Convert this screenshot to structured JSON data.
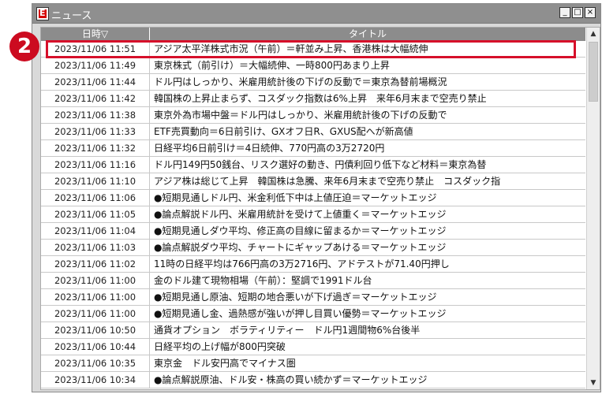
{
  "window": {
    "title": "ニュース",
    "minimize_label": "_",
    "maximize_label": "□",
    "close_label": "×"
  },
  "callout": {
    "number": "2"
  },
  "table": {
    "columns": {
      "date": "日時▽",
      "title": "タイトル"
    },
    "rows": [
      {
        "date": "2023/11/06 11:51",
        "title": "アジア太平洋株式市況（午前）＝軒並み上昇、香港株は大幅続伸"
      },
      {
        "date": "2023/11/06 11:49",
        "title": "東京株式（前引け）＝大幅続伸、一時800円あまり上昇"
      },
      {
        "date": "2023/11/06 11:44",
        "title": "ドル円はしっかり、米雇用統計後の下げの反動で＝東京為替前場概況"
      },
      {
        "date": "2023/11/06 11:42",
        "title": "韓国株の上昇止まらず、コスダック指数は6%上昇　来年6月末まで空売り禁止"
      },
      {
        "date": "2023/11/06 11:38",
        "title": "東京外為市場中盤＝ドル円はしっかり、米雇用統計後の下げの反動で"
      },
      {
        "date": "2023/11/06 11:33",
        "title": "ETF売買動向＝6日前引け、GXオフ日R、GXUS配へが新高値"
      },
      {
        "date": "2023/11/06 11:32",
        "title": "日経平均6日前引け＝4日続伸、770円高の3万2720円"
      },
      {
        "date": "2023/11/06 11:16",
        "title": "ドル円149円50銭台、リスク選好の動き、円債利回り低下など材料＝東京為替"
      },
      {
        "date": "2023/11/06 11:10",
        "title": "アジア株は総じて上昇　韓国株は急騰、来年6月末まで空売り禁止　コスダック指"
      },
      {
        "date": "2023/11/06 11:06",
        "title": "●短期見通しドル円、米金利低下中は上値圧迫＝マーケットエッジ"
      },
      {
        "date": "2023/11/06 11:05",
        "title": "●論点解説ドル円、米雇用統計を受けて上値重く＝マーケットエッジ"
      },
      {
        "date": "2023/11/06 11:04",
        "title": "●短期見通しダウ平均、修正高の目線に留まるか＝マーケットエッジ"
      },
      {
        "date": "2023/11/06 11:03",
        "title": "●論点解説ダウ平均、チャートにギャップあける＝マーケットエッジ"
      },
      {
        "date": "2023/11/06 11:02",
        "title": "11時の日経平均は766円高の3万2716円、アドテストが71.40円押し"
      },
      {
        "date": "2023/11/06 11:00",
        "title": "金のドル建て現物相場（午前）：堅調で1991ドル台"
      },
      {
        "date": "2023/11/06 11:00",
        "title": "●短期見通し原油、短期の地合悪いが下げ過ぎ＝マーケットエッジ"
      },
      {
        "date": "2023/11/06 11:00",
        "title": "●短期見通し金、過熱感が強いが押し目買い優勢＝マーケットエッジ"
      },
      {
        "date": "2023/11/06 10:50",
        "title": "通貨オプション　ボラティリティー　ドル円1週間物6%台後半"
      },
      {
        "date": "2023/11/06 10:44",
        "title": "日経平均の上げ幅が800円突破"
      },
      {
        "date": "2023/11/06 10:35",
        "title": "東京金　ドル安円高でマイナス圏"
      },
      {
        "date": "2023/11/06 10:34",
        "title": "●論点解説原油、ドル安・株高の買い続かず＝マーケットエッジ"
      }
    ]
  },
  "scrollbar": {
    "up_label": "▲",
    "down_label": "▼"
  },
  "colors": {
    "highlight": "#d60f2a",
    "badge": "#cc0b20",
    "header": "#8c8c8c",
    "titlebar": "#8f8f8f"
  }
}
